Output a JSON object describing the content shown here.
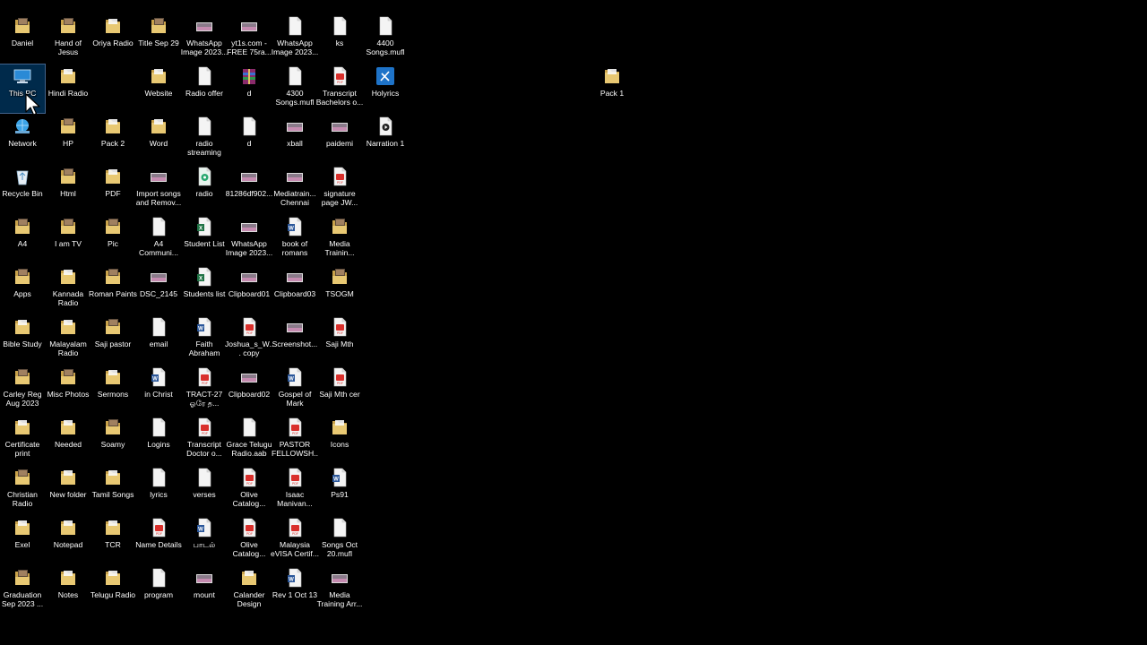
{
  "desktop": {
    "icons": [
      {
        "label": "Daniel",
        "type": "folder-img"
      },
      {
        "label": "This PC",
        "type": "pc",
        "selected": true
      },
      {
        "label": "Network",
        "type": "network"
      },
      {
        "label": "Recycle Bin",
        "type": "recycle"
      },
      {
        "label": "A4",
        "type": "folder-img"
      },
      {
        "label": "Apps",
        "type": "folder-img"
      },
      {
        "label": "Bible Study",
        "type": "folder"
      },
      {
        "label": "Carley Reg Aug 2023",
        "type": "folder-img"
      },
      {
        "label": "Certificate print",
        "type": "folder"
      },
      {
        "label": "Christian Radio",
        "type": "folder-img"
      },
      {
        "label": "Exel",
        "type": "folder"
      },
      {
        "label": "Graduation Sep 2023 ...",
        "type": "folder-img"
      },
      {
        "label": "Hand of Jesus",
        "type": "folder-img"
      },
      {
        "label": "Hindi Radio",
        "type": "folder"
      },
      {
        "label": "HP",
        "type": "folder-img"
      },
      {
        "label": "Html",
        "type": "folder-img"
      },
      {
        "label": "I am TV",
        "type": "folder-img"
      },
      {
        "label": "Kannada Radio",
        "type": "folder"
      },
      {
        "label": "Malayalam Radio",
        "type": "folder"
      },
      {
        "label": "Misc Photos",
        "type": "folder-img"
      },
      {
        "label": "Needed",
        "type": "folder"
      },
      {
        "label": "New folder",
        "type": "folder"
      },
      {
        "label": "Notepad",
        "type": "folder"
      },
      {
        "label": "Notes",
        "type": "folder"
      },
      {
        "label": "Oriya Radio",
        "type": "folder"
      },
      {
        "label": "Pack 2",
        "type": "folder"
      },
      {
        "label": "PDF",
        "type": "folder"
      },
      {
        "label": "Pic",
        "type": "folder-img"
      },
      {
        "label": "Roman Paints",
        "type": "folder-img"
      },
      {
        "label": "Saji pastor",
        "type": "folder-img"
      },
      {
        "label": "Sermons",
        "type": "folder"
      },
      {
        "label": "Soamy",
        "type": "folder-img"
      },
      {
        "label": "Tamil Songs",
        "type": "folder"
      },
      {
        "label": "TCR",
        "type": "folder"
      },
      {
        "label": "Telugu Radio",
        "type": "folder"
      },
      {
        "label": "Title Sep 29",
        "type": "folder-img"
      },
      {
        "label": "Website",
        "type": "folder"
      },
      {
        "label": "Word",
        "type": "folder"
      },
      {
        "label": "Import songs and Remov...",
        "type": "image"
      },
      {
        "label": "A4 Communi...",
        "type": "file"
      },
      {
        "label": "DSC_2145",
        "type": "image"
      },
      {
        "label": "email",
        "type": "file"
      },
      {
        "label": "in Christ",
        "type": "word"
      },
      {
        "label": "Logins",
        "type": "file"
      },
      {
        "label": "lyrics",
        "type": "file"
      },
      {
        "label": "Name Details",
        "type": "pdf"
      },
      {
        "label": "program",
        "type": "file"
      },
      {
        "label": "WhatsApp Image 2023...",
        "type": "image"
      },
      {
        "label": "Radio offer",
        "type": "file"
      },
      {
        "label": "radio streaming",
        "type": "file"
      },
      {
        "label": "radio",
        "type": "app"
      },
      {
        "label": "Student List",
        "type": "excel"
      },
      {
        "label": "Students list",
        "type": "excel"
      },
      {
        "label": "Faith Abraham",
        "type": "word"
      },
      {
        "label": "TRACT-27 ஓரே த...",
        "type": "pdf"
      },
      {
        "label": "Transcript Doctor o...",
        "type": "pdf"
      },
      {
        "label": "verses",
        "type": "file"
      },
      {
        "label": "பாடல்",
        "type": "word"
      },
      {
        "label": "mount",
        "type": "image"
      },
      {
        "label": "yt1s.com - FREE 75ra...",
        "type": "image"
      },
      {
        "label": "d",
        "type": "rar"
      },
      {
        "label": "d",
        "type": "file"
      },
      {
        "label": "81286df902...",
        "type": "image"
      },
      {
        "label": "WhatsApp Image 2023...",
        "type": "image"
      },
      {
        "label": "Clipboard01",
        "type": "image"
      },
      {
        "label": "Joshua_s_W... copy",
        "type": "pdf"
      },
      {
        "label": "Clipboard02",
        "type": "image"
      },
      {
        "label": "Grace Telugu Radio.aab",
        "type": "file"
      },
      {
        "label": "Olive Catalog...",
        "type": "pdf"
      },
      {
        "label": "Olive Catalog...",
        "type": "pdf"
      },
      {
        "label": "Calander Design",
        "type": "folder"
      },
      {
        "label": "WhatsApp Image 2023...",
        "type": "file"
      },
      {
        "label": "4300 Songs.mufl",
        "type": "file"
      },
      {
        "label": "xball",
        "type": "image"
      },
      {
        "label": "Mediatrain... Chennai",
        "type": "image"
      },
      {
        "label": "book of romans",
        "type": "word"
      },
      {
        "label": "Clipboard03",
        "type": "image"
      },
      {
        "label": "Screenshot...",
        "type": "image"
      },
      {
        "label": "Gospel of Mark",
        "type": "word"
      },
      {
        "label": "PASTOR FELLOWSH...",
        "type": "pdf"
      },
      {
        "label": "Isaac Manivan...",
        "type": "pdf"
      },
      {
        "label": "Malaysia eVISA Certif...",
        "type": "pdf"
      },
      {
        "label": "Rev 1 Oct 13",
        "type": "word"
      },
      {
        "label": "ks",
        "type": "file"
      },
      {
        "label": "Transcript Bachelors o...",
        "type": "pdf"
      },
      {
        "label": "paidemi",
        "type": "image"
      },
      {
        "label": "signature page JW...",
        "type": "pdf"
      },
      {
        "label": "Media Trainin...",
        "type": "folder-img"
      },
      {
        "label": "TSOGM",
        "type": "folder-img"
      },
      {
        "label": "Saji Mth",
        "type": "pdf"
      },
      {
        "label": "Saji Mth cer",
        "type": "pdf"
      },
      {
        "label": "Icons",
        "type": "folder"
      },
      {
        "label": "Ps91",
        "type": "word"
      },
      {
        "label": "Songs Oct 20.mufl",
        "type": "file"
      },
      {
        "label": "Media Training Arr...",
        "type": "image"
      },
      {
        "label": "4400 Songs.mufl",
        "type": "file"
      },
      {
        "label": "Holyrics",
        "type": "app2"
      },
      {
        "label": "Narration 1",
        "type": "media"
      },
      {
        "label": "Pack 1",
        "type": "folder"
      }
    ]
  },
  "colors": {
    "folder": "#e8c872",
    "folder_dark": "#c9a24a",
    "pdf": "#d9302c",
    "word": "#2b579a",
    "excel": "#217346",
    "selection": "#0078d7"
  }
}
